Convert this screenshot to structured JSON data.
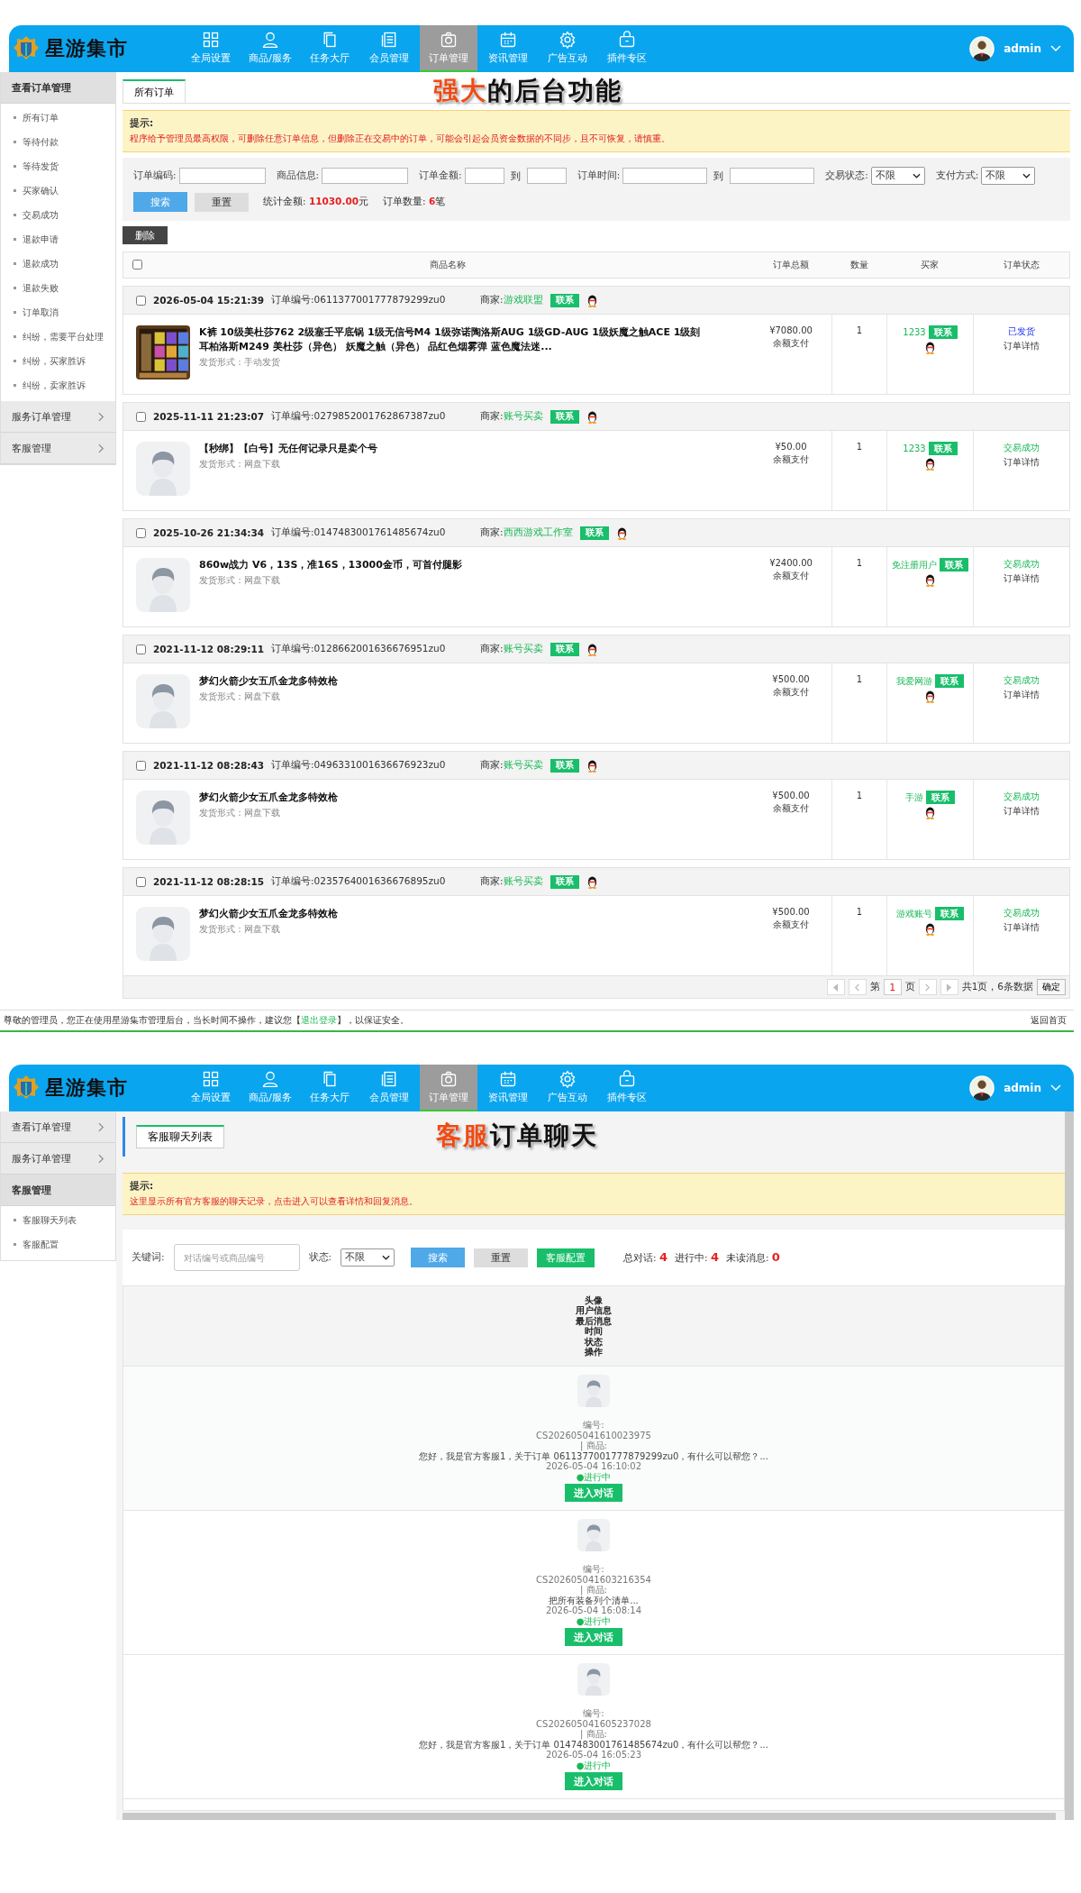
{
  "orders_screen": {
    "header": {
      "logo": "星游集市",
      "nav": [
        {
          "label": "全局设置",
          "selected": false
        },
        {
          "label": "商品/服务",
          "selected": false
        },
        {
          "label": "任务大厅",
          "selected": false
        },
        {
          "label": "会员管理",
          "selected": false
        },
        {
          "label": "订单管理",
          "selected": true
        },
        {
          "label": "资讯管理",
          "selected": false
        },
        {
          "label": "广告互动",
          "selected": false
        },
        {
          "label": "插件专区",
          "selected": false
        }
      ],
      "user": "admin"
    },
    "sidebar": [
      {
        "label": "查看订单管理",
        "expanded": true,
        "items": [
          "所有订单",
          "等待付款",
          "等待发货",
          "买家确认",
          "交易成功",
          "退款申请",
          "退款成功",
          "退款失败",
          "订单取消",
          "纠纷，需要平台处理",
          "纠纷，买家胜诉",
          "纠纷，卖家胜诉"
        ]
      },
      {
        "label": "服务订单管理",
        "expanded": false
      },
      {
        "label": "客服管理",
        "expanded": false
      }
    ],
    "tabs": [
      {
        "label": "所有订单",
        "selected": true
      }
    ],
    "caption": {
      "highlight": "强大",
      "text": "的后台功能"
    },
    "notice": {
      "title": "提示:",
      "text": "程序给予管理员最高权限，可删除任意订单信息，但删除正在交易中的订单，可能会引起会员资金数据的不同步，且不可恢复，请慎重。"
    },
    "filters": [
      {
        "kind": "text",
        "label": "订单编码:"
      },
      {
        "kind": "text",
        "label": "商品信息:"
      },
      {
        "kind": "range",
        "label": "订单金额:",
        "separator": "到"
      },
      {
        "kind": "date_range",
        "label": "订单时间:",
        "separator": "到"
      },
      {
        "kind": "select",
        "label": "交易状态:",
        "value": "不限"
      },
      {
        "kind": "select",
        "label": "支付方式:",
        "value": "不限"
      }
    ],
    "search_button": "搜索",
    "reset_button": "重置",
    "stats": [
      {
        "label": "统计金额:",
        "value": "11030.00",
        "unit": "元"
      },
      {
        "label": "订单数量:",
        "value": "6",
        "unit": "笔"
      }
    ],
    "delete_button": "删除",
    "table": {
      "select_all": false,
      "columns": [
        "商品名称",
        "订单总额",
        "数量",
        "买家",
        "订单状态"
      ]
    },
    "orders": [
      {
        "checked": false,
        "time": "2026-05-04 15:21:39",
        "order_no_label": "订单编号:",
        "order_no": "0611377001777879299zu0",
        "seller_label": "商家:",
        "seller": "游戏联盟",
        "contact": "联系",
        "title": "K裤 10级美杜莎762 2级塞壬平底锅 1级无信号M4 1级弥诺陶洛斯AUG 1级GD-AUG 1级妖魔之触ACE 1级刻耳柏洛斯M249 美杜莎（异色） 妖魔之触（异色） 品红色烟雾弹 蓝色魔法迷...",
        "delivery": "发货形式：手动发货",
        "amount": "¥7080.00",
        "payment": "余额支付",
        "qty": "1",
        "buyer": "1233",
        "buyer_contact": "联系",
        "status": {
          "kind": "shipped",
          "text": "已发货"
        },
        "detail": "订单详情"
      },
      {
        "checked": false,
        "time": "2025-11-11 21:23:07",
        "order_no_label": "订单编号:",
        "order_no": "0279852001762867387zu0",
        "seller_label": "商家:",
        "seller": "账号买卖",
        "contact": "联系",
        "thumb": {
          "kind": "placeholder"
        },
        "title": "【秒绑】【白号】无任何记录只是卖个号",
        "delivery": "发货形式：网盘下载",
        "amount": "¥50.00",
        "payment": "余额支付",
        "qty": "1",
        "buyer": "1233",
        "buyer_contact": "联系",
        "status": {
          "kind": "success",
          "text": "交易成功"
        },
        "detail": "订单详情"
      },
      {
        "checked": false,
        "time": "2025-10-26 21:34:34",
        "order_no_label": "订单编号:",
        "order_no": "0147483001761485674zu0",
        "seller_label": "商家:",
        "seller": "西西游戏工作室",
        "contact": "联系",
        "thumb": {
          "kind": "placeholder"
        },
        "title": "860w战力 V6，13S，准16S，13000金币，可首付腿影",
        "delivery": "发货形式：网盘下载",
        "amount": "¥2400.00",
        "payment": "余额支付",
        "qty": "1",
        "buyer": "免注册用户",
        "buyer_contact": "联系",
        "status": {
          "kind": "success",
          "text": "交易成功"
        },
        "detail": "订单详情"
      },
      {
        "checked": false,
        "time": "2021-11-12 08:29:11",
        "order_no_label": "订单编号:",
        "order_no": "0128662001636676951zu0",
        "seller_label": "商家:",
        "seller": "账号买卖",
        "contact": "联系",
        "thumb": {
          "kind": "placeholder"
        },
        "title": "梦幻火箭少女五爪金龙多特效枪",
        "delivery": "发货形式：网盘下载",
        "amount": "¥500.00",
        "payment": "余额支付",
        "qty": "1",
        "buyer": "我爱网游",
        "buyer_contact": "联系",
        "status": {
          "kind": "success",
          "text": "交易成功"
        },
        "detail": "订单详情"
      },
      {
        "checked": false,
        "time": "2021-11-12 08:28:43",
        "order_no_label": "订单编号:",
        "order_no": "0496331001636676923zu0",
        "seller_label": "商家:",
        "seller": "账号买卖",
        "contact": "联系",
        "thumb": {
          "kind": "placeholder"
        },
        "title": "梦幻火箭少女五爪金龙多特效枪",
        "delivery": "发货形式：网盘下载",
        "amount": "¥500.00",
        "payment": "余额支付",
        "qty": "1",
        "buyer": "手游",
        "buyer_contact": "联系",
        "status": {
          "kind": "success",
          "text": "交易成功"
        },
        "detail": "订单详情"
      },
      {
        "checked": false,
        "time": "2021-11-12 08:28:15",
        "order_no_label": "订单编号:",
        "order_no": "0235764001636676895zu0",
        "seller_label": "商家:",
        "seller": "账号买卖",
        "contact": "联系",
        "thumb": {
          "kind": "placeholder"
        },
        "title": "梦幻火箭少女五爪金龙多特效枪",
        "delivery": "发货形式：网盘下载",
        "amount": "¥500.00",
        "payment": "余额支付",
        "qty": "1",
        "buyer": "游戏账号",
        "buyer_contact": "联系",
        "status": {
          "kind": "success",
          "text": "交易成功"
        },
        "detail": "订单详情"
      }
    ],
    "pager": {
      "before": "第",
      "page": "1",
      "after": "页",
      "summary": "共1页，6条数据",
      "confirm": "确定"
    },
    "status_bar": {
      "before": "尊敬的管理员，您正在使用星游集市管理后台，当长时间不操作，建议您【",
      "link": "退出登录",
      "after": "】，以保证安全。",
      "home": "返回首页"
    }
  },
  "chat_screen": {
    "header": {
      "logo": "星游集市",
      "nav": [
        {
          "label": "全局设置",
          "selected": false
        },
        {
          "label": "商品/服务",
          "selected": false
        },
        {
          "label": "任务大厅",
          "selected": false
        },
        {
          "label": "会员管理",
          "selected": false
        },
        {
          "label": "订单管理",
          "selected": true
        },
        {
          "label": "资讯管理",
          "selected": false
        },
        {
          "label": "广告互动",
          "selected": false
        },
        {
          "label": "插件专区",
          "selected": false
        }
      ],
      "user": "admin"
    },
    "sidebar": [
      {
        "label": "查看订单管理",
        "expanded": false
      },
      {
        "label": "服务订单管理",
        "expanded": false
      },
      {
        "label": "客服管理",
        "expanded": true,
        "items": [
          "客服聊天列表",
          "客服配置"
        ]
      }
    ],
    "tabs": [
      {
        "label": "客服聊天列表",
        "selected": true
      }
    ],
    "caption": {
      "highlight": "客服",
      "text": "订单聊天"
    },
    "notice": {
      "title": "提示:",
      "text": "这里显示所有官方客服的聊天记录，点击进入可以查看详情和回复消息。"
    },
    "keyword_label": "关键词:",
    "keyword_placeholder": "对话编号或商品编号",
    "status_label": "状态:",
    "status_value": "不限",
    "search_button": "搜索",
    "reset_button": "重置",
    "config_button": "客服配置",
    "stats": [
      {
        "label": "总对话:",
        "value": "4"
      },
      {
        "label": "进行中:",
        "value": "4"
      },
      {
        "label": "未读消息:",
        "value": "0"
      }
    ],
    "columns": [
      "头像",
      "用户信息",
      "最后消息",
      "时间",
      "状态",
      "操作"
    ],
    "chats": [
      {
        "no_label": "编号:",
        "no": "CS202605041610023975",
        "product_label": "| 商品:",
        "message": "您好，我是官方客服1，关于订单 0611377001777879299zu0，有什么可以帮您？...",
        "time": "2026-05-04 16:10:02",
        "status": "●进行中",
        "action": "进入对话"
      },
      {
        "no_label": "编号:",
        "no": "CS202605041603216354",
        "product_label": "| 商品:",
        "message": "把所有装备列个清单...",
        "time": "2026-05-04 16:08:14",
        "status": "●进行中",
        "action": "进入对话"
      },
      {
        "no_label": "编号:",
        "no": "CS202605041605237028",
        "product_label": "| 商品:",
        "message": "您好，我是官方客服1，关于订单 0147483001761485674zu0，有什么可以帮您？...",
        "time": "2026-05-04 16:05:23",
        "status": "●进行中",
        "action": "进入对话"
      }
    ]
  }
}
